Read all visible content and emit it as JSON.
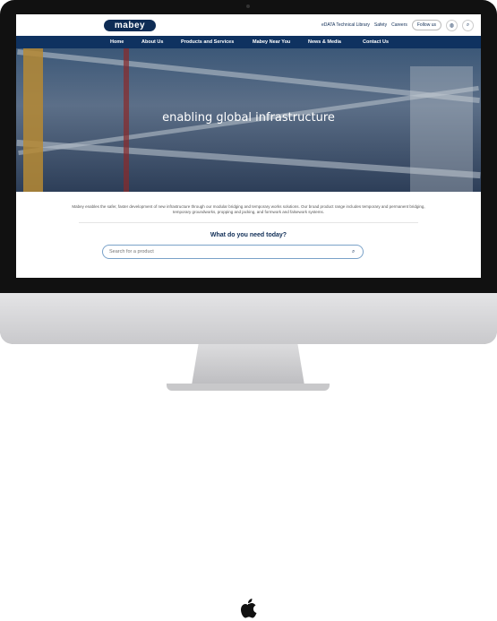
{
  "header": {
    "logo_text": "mabey",
    "utility_links": [
      "eDATA Technical Library",
      "Safety",
      "Careers"
    ],
    "follow_label": "Follow us"
  },
  "nav": {
    "items": [
      "Home",
      "About Us",
      "Products and Services",
      "Mabey Near You",
      "News & Media",
      "Contact Us"
    ]
  },
  "hero": {
    "title": "enabling global infrastructure"
  },
  "intro": {
    "text": "Mabey enables the safer, faster development of new infrastructure through our modular bridging and temporary works solutions. Our broad product range includes temporary and permanent bridging, temporary groundworks, propping and jacking, and formwork and falsework systems."
  },
  "search": {
    "heading": "What do you need today?",
    "placeholder": "Search for a product"
  },
  "colors": {
    "brand": "#0e2c55",
    "nav_bg": "#0f3260"
  },
  "icons": [
    "globe-icon",
    "search-icon",
    "apple-logo"
  ]
}
